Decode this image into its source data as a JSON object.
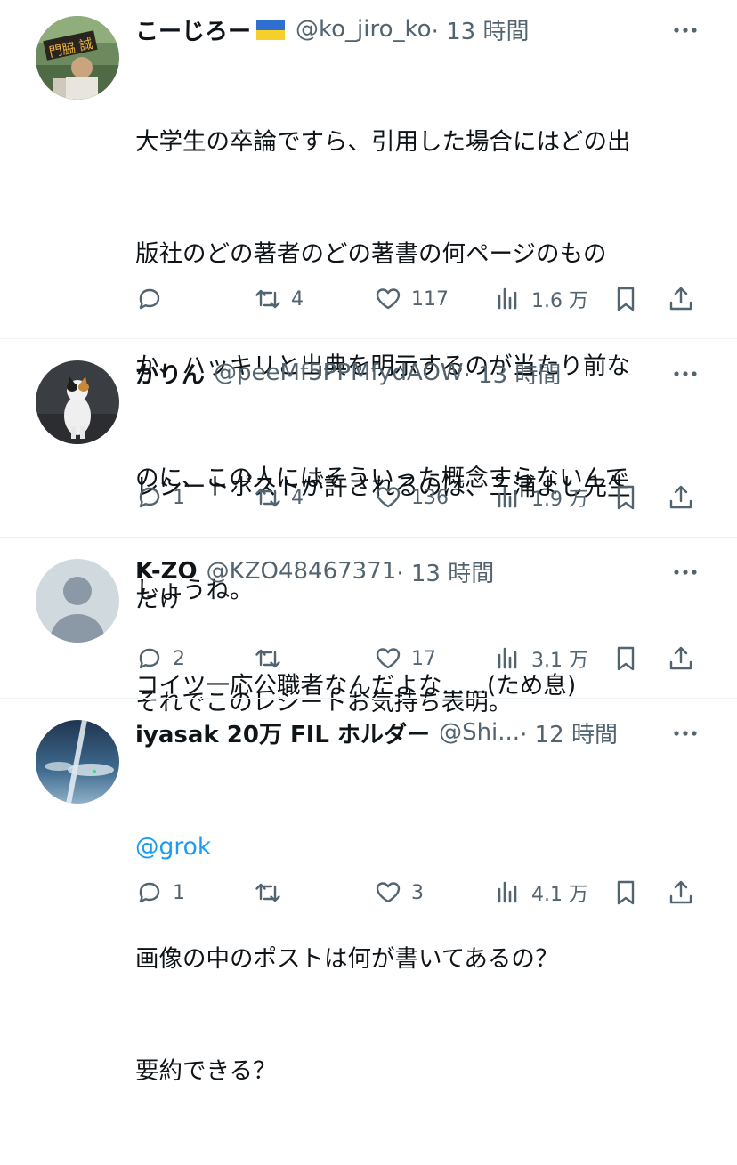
{
  "colors": {
    "text": "#0f1419",
    "secondary": "#536471",
    "link": "#1d9bf0",
    "separator": "#eff3f4"
  },
  "posts": [
    {
      "name": "こーじろー",
      "flag": "ukraine-flag",
      "handle": "@ko_jiro_ko",
      "time": "· 13 時間",
      "lines": [
        "大学生の卒論ですら、引用した場合にはどの出",
        "版社のどの著者のどの著書の何ページのもの",
        "か、ハッキリと出典を明示するのが当たり前な",
        "のに、この人にはそういった概念すらないんで",
        "しょうね。",
        "それでこのレシートお気持ち表明。"
      ],
      "replies": "",
      "reposts": "4",
      "likes": "117",
      "views": "1.6 万"
    },
    {
      "name": "かりん",
      "handle": "@peeMf5PPMfydAOW",
      "time": "· 13 時間",
      "lines": [
        "レシートポストが許されるのは、三浦よし先生",
        "だけ"
      ],
      "replies": "1",
      "reposts": "4",
      "likes": "136",
      "views": "1.9 万"
    },
    {
      "name": "K-ZO",
      "handle": "@KZO48467371",
      "time": "· 13 時間",
      "lines": [
        "コイツ一応公職者なんだよな......(ため息)"
      ],
      "replies": "2",
      "reposts": "",
      "likes": "17",
      "views": "3.1 万"
    },
    {
      "name": "iyasak 20万 FIL ホルダー",
      "handle": "@Shi...",
      "time": "· 12 時間",
      "mention": "@grok",
      "lines": [
        "画像の中のポストは何が書いてあるの？",
        "要約できる？"
      ],
      "replies": "1",
      "reposts": "",
      "likes": "3",
      "views": "4.1 万"
    }
  ]
}
